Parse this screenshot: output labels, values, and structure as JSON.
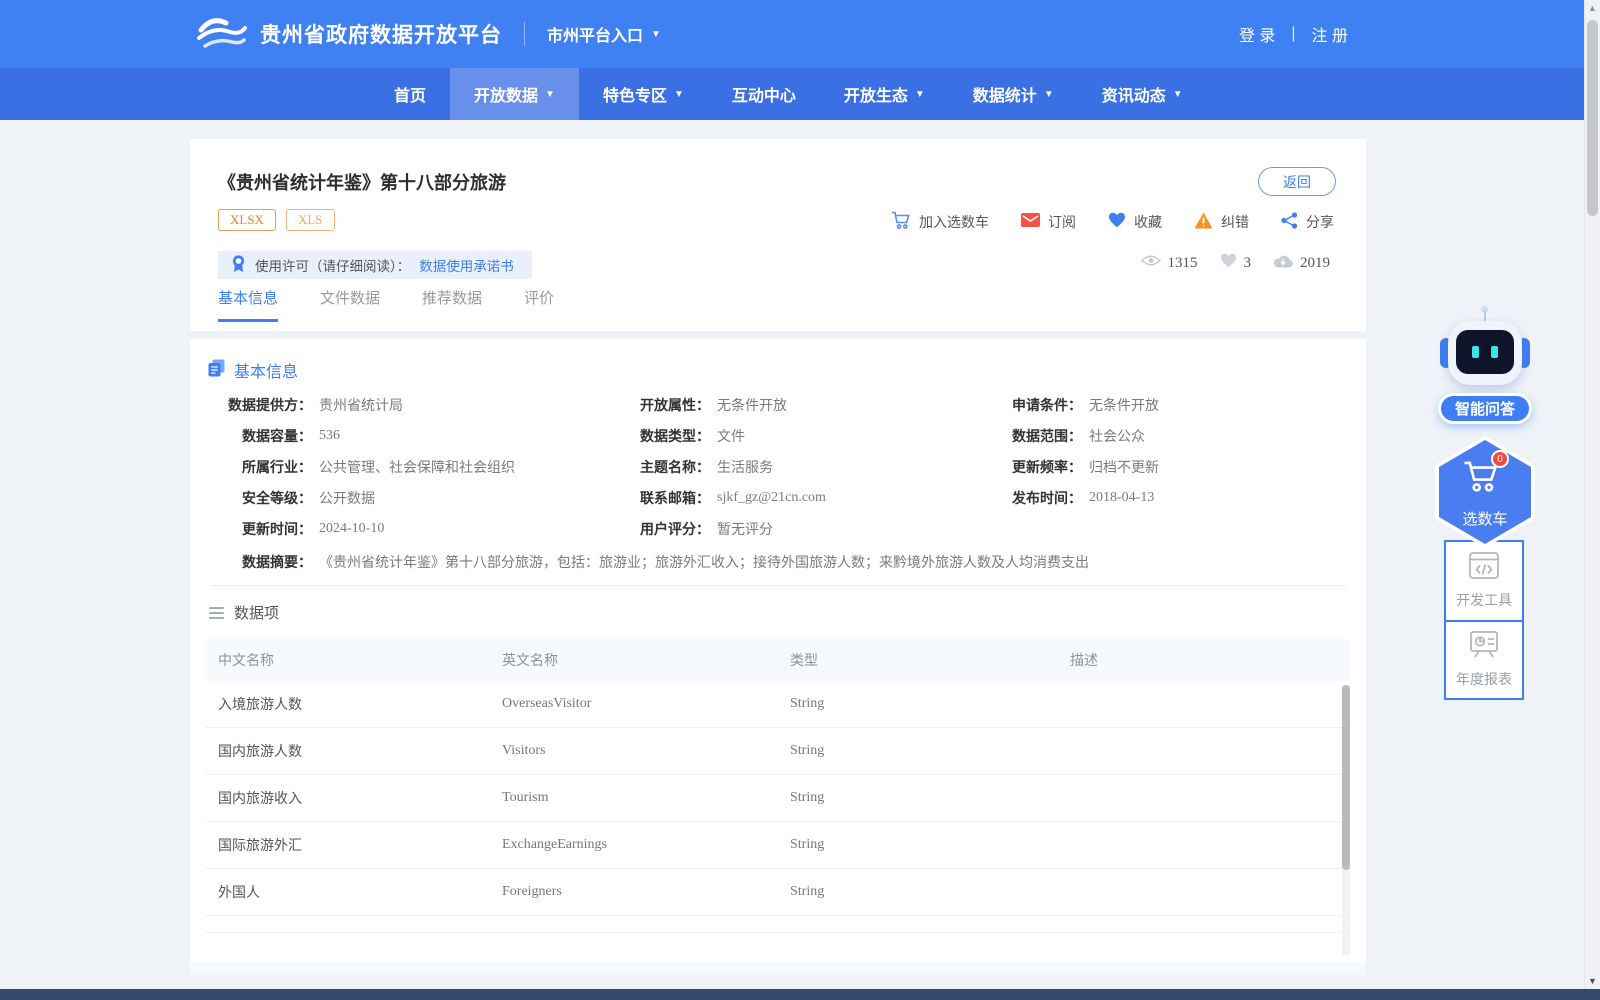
{
  "header": {
    "brand": "贵州省政府数据开放平台",
    "portal_entry": "市州平台入口",
    "login": "登 录",
    "register": "注 册"
  },
  "nav": {
    "items": [
      {
        "label": "首页"
      },
      {
        "label": "开放数据"
      },
      {
        "label": "特色专区"
      },
      {
        "label": "互动中心"
      },
      {
        "label": "开放生态"
      },
      {
        "label": "数据统计"
      },
      {
        "label": "资讯动态"
      }
    ]
  },
  "dataset": {
    "title": "《贵州省统计年鉴》第十八部分旅游",
    "back_label": "返回",
    "format_badges": [
      "XLSX",
      "XLS"
    ],
    "actions": {
      "add_cart": "加入选数车",
      "subscribe": "订阅",
      "favorite": "收藏",
      "correct": "纠错",
      "share": "分享"
    },
    "license": {
      "label": "使用许可（请仔细阅读）：",
      "link": "数据使用承诺书"
    },
    "stats": {
      "views": "1315",
      "likes": "3",
      "downloads": "2019"
    },
    "tabs": [
      {
        "label": "基本信息"
      },
      {
        "label": "文件数据"
      },
      {
        "label": "推荐数据"
      },
      {
        "label": "评价"
      }
    ]
  },
  "basic_info": {
    "section_title": "基本信息",
    "fields": [
      {
        "label": "数据提供方：",
        "value": "贵州省统计局"
      },
      {
        "label": "开放属性：",
        "value": "无条件开放"
      },
      {
        "label": "申请条件：",
        "value": "无条件开放"
      },
      {
        "label": "数据容量：",
        "value": "536"
      },
      {
        "label": "数据类型：",
        "value": "文件"
      },
      {
        "label": "数据范围：",
        "value": "社会公众"
      },
      {
        "label": "所属行业：",
        "value": "公共管理、社会保障和社会组织"
      },
      {
        "label": "主题名称：",
        "value": "生活服务"
      },
      {
        "label": "更新频率：",
        "value": "归档不更新"
      },
      {
        "label": "安全等级：",
        "value": "公开数据"
      },
      {
        "label": "联系邮箱：",
        "value": "sjkf_gz@21cn.com"
      },
      {
        "label": "发布时间：",
        "value": "2018-04-13"
      },
      {
        "label": "更新时间：",
        "value": "2024-10-10"
      },
      {
        "label": "用户评分：",
        "value": "暂无评分"
      }
    ],
    "summary_label": "数据摘要：",
    "summary_value": "《贵州省统计年鉴》第十八部分旅游，包括：旅游业；旅游外汇收入；接待外国旅游人数；来黔境外旅游人数及人均消费支出"
  },
  "data_items": {
    "section_title": "数据项",
    "columns": [
      "中文名称",
      "英文名称",
      "类型",
      "描述"
    ],
    "rows": [
      {
        "cn": "入境旅游人数",
        "en": "OverseasVisitor",
        "type": "String",
        "desc": ""
      },
      {
        "cn": "国内旅游人数",
        "en": "Visitors",
        "type": "String",
        "desc": ""
      },
      {
        "cn": "国内旅游收入",
        "en": "Tourism",
        "type": "String",
        "desc": ""
      },
      {
        "cn": "国际旅游外汇",
        "en": "ExchangeEarnings",
        "type": "String",
        "desc": ""
      },
      {
        "cn": "外国人",
        "en": "Foreigners",
        "type": "String",
        "desc": ""
      }
    ]
  },
  "floating": {
    "qa_label": "智能问答",
    "cart_label": "选数车",
    "cart_count": "0",
    "dev_tools_label": "开发工具",
    "annual_report_label": "年度报表"
  },
  "colors": {
    "header_blue": "#3f80f2",
    "nav_blue": "#3a70e4",
    "nav_active_blue": "#688fe9",
    "accent_blue": "#3f7ef2",
    "badge_orange": "#ee7d22",
    "subscribe_red": "#f25449",
    "warning_orange": "#f7941e",
    "page_bg": "#eff3f8",
    "footer_dark": "#34496b"
  }
}
